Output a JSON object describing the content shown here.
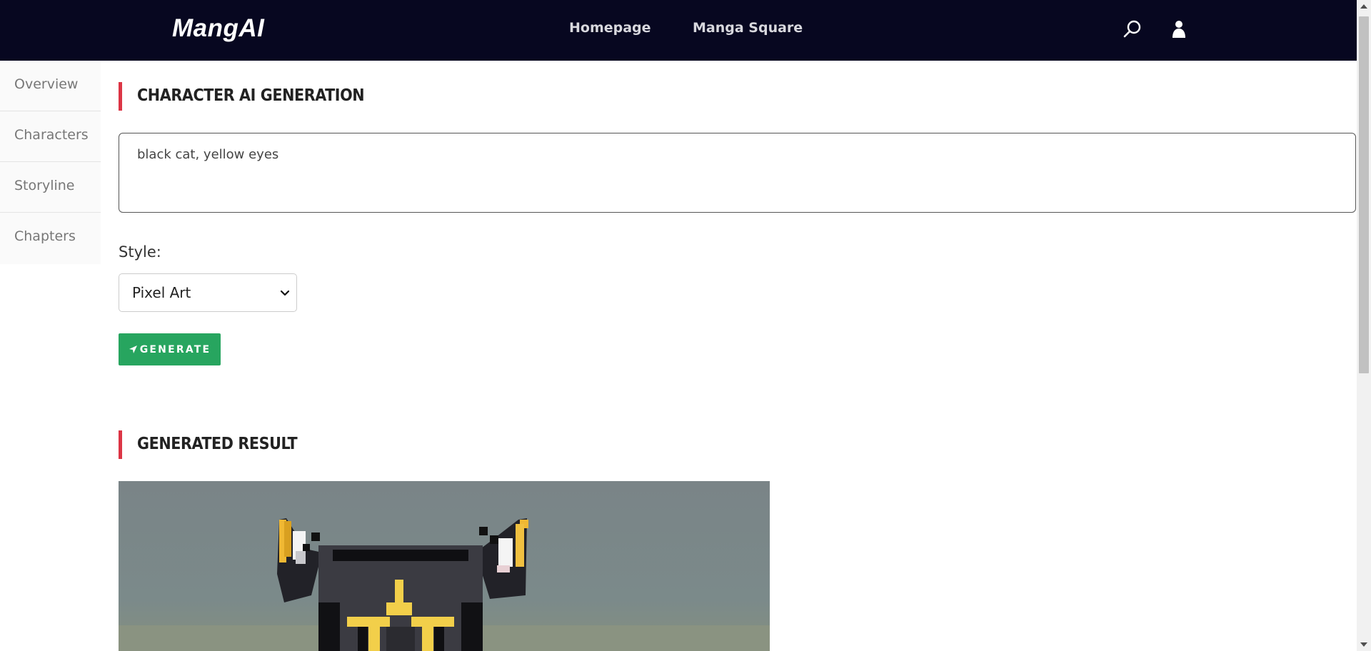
{
  "header": {
    "logo": "MangAI",
    "nav": [
      {
        "label": "Homepage"
      },
      {
        "label": "Manga Square"
      }
    ],
    "icons": [
      "search-icon",
      "user-icon"
    ]
  },
  "sidebar": {
    "items": [
      {
        "label": "Overview"
      },
      {
        "label": "Characters"
      },
      {
        "label": "Storyline"
      },
      {
        "label": "Chapters"
      }
    ]
  },
  "generation": {
    "title": "CHARACTER AI GENERATION",
    "prompt_value": "black cat, yellow eyes",
    "style_label": "Style:",
    "style_selected": "Pixel Art",
    "generate_label": "GENERATE"
  },
  "result": {
    "title": "GENERATED RESULT",
    "image_subject": "pixel-art black cat with yellow eyes"
  },
  "colors": {
    "header_bg": "#070720",
    "accent_bar": "#dc3545",
    "button_green": "#27a55f"
  }
}
